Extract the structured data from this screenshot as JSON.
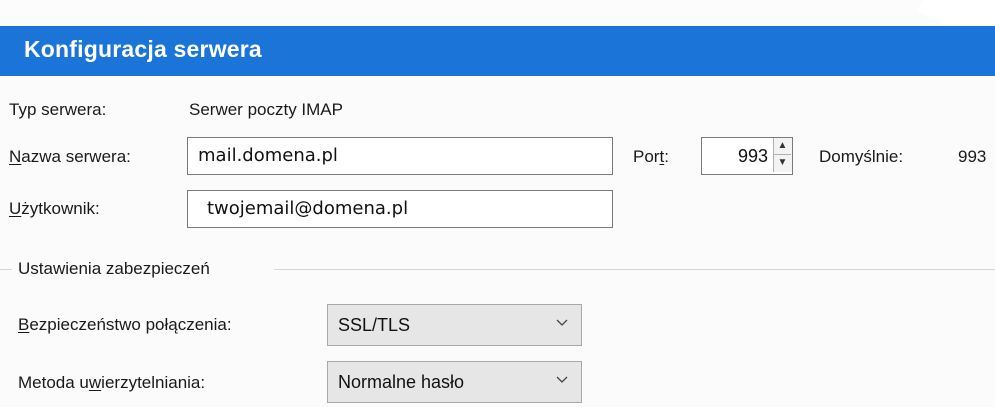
{
  "dialog": {
    "title": "Konfiguracja serwera"
  },
  "server_type": {
    "label": "Typ serwera:",
    "value": "Serwer poczty IMAP"
  },
  "server_name": {
    "label_pre": "",
    "label_mnemonic": "N",
    "label_post": "azwa serwera:",
    "value": "mail.domena.pl"
  },
  "port": {
    "label_pre": "Por",
    "label_mnemonic": "t",
    "label_post": ":",
    "value": "993",
    "default_label": "Domyślnie:",
    "default_value": "993"
  },
  "username": {
    "label_pre": "",
    "label_mnemonic": "U",
    "label_post": "żytkownik:",
    "value": "twojemail@domena.pl"
  },
  "security_group": {
    "title": "Ustawienia zabezpieczeń",
    "connection_security": {
      "label_pre": "",
      "label_mnemonic": "B",
      "label_post": "ezpieczeństwo połączenia:",
      "selected": "SSL/TLS"
    },
    "auth_method": {
      "label_pre": "Metoda u",
      "label_mnemonic": "w",
      "label_post": "ierzytelniania:",
      "selected": "Normalne hasło"
    }
  },
  "icons": {
    "spin_up": "triangle-up-icon",
    "spin_down": "triangle-down-icon",
    "dropdown": "chevron-down-icon"
  },
  "colors": {
    "header": "#1b74d8",
    "header_text": "#ffffff"
  }
}
